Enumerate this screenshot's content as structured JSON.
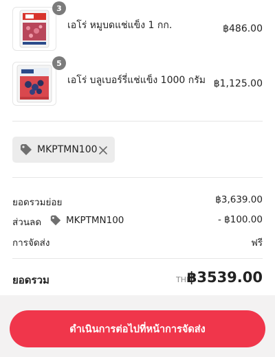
{
  "items": [
    {
      "quantity": "3",
      "name": "เอโร่ หมูบดแช่แข็ง 1 กก.",
      "price": "฿486.00"
    },
    {
      "quantity": "5",
      "name": "เอโร่ บลูเบอร์รี่แช่แข็ง 1000 กรัม",
      "price": "฿1,125.00"
    }
  ],
  "discount_chip": {
    "code": "MKPTMN100"
  },
  "summary": {
    "subtotal_label": "ยอดรวมย่อย",
    "subtotal_value": "฿3,639.00",
    "discount_label": "ส่วนลด",
    "discount_code": "MKPTMN100",
    "discount_value": "- ฿100.00",
    "shipping_label": "การจัดส่ง",
    "shipping_value": "ฟรี"
  },
  "total": {
    "label": "ยอดรวม",
    "currency": "THB",
    "value": "฿3539.00"
  },
  "cta": {
    "label": "ดำเนินการต่อไปที่หน้าการจัดส่ง"
  },
  "colors": {
    "accent": "#f0364b",
    "chip_bg": "#ececec",
    "badge": "#7b7b7b"
  }
}
